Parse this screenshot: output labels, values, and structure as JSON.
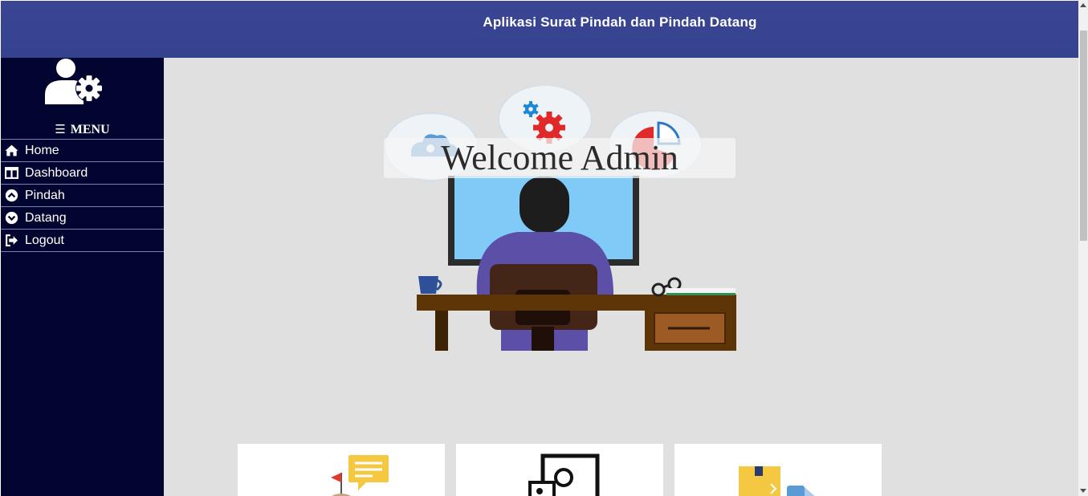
{
  "header": {
    "title": "Aplikasi Surat Pindah dan Pindah Datang"
  },
  "sidebar": {
    "menu_label": "MENU",
    "items": [
      {
        "label": "Home",
        "icon": "home-icon"
      },
      {
        "label": "Dashboard",
        "icon": "columns-icon"
      },
      {
        "label": "Pindah",
        "icon": "chevron-circle-up-icon"
      },
      {
        "label": "Datang",
        "icon": "chevron-circle-down-icon"
      },
      {
        "label": "Logout",
        "icon": "sign-out-icon"
      }
    ]
  },
  "main": {
    "welcome_text": "Welcome Admin"
  },
  "colors": {
    "header": "#3a4694",
    "sidebar": "#020530",
    "content_bg": "#e0e0e0"
  }
}
